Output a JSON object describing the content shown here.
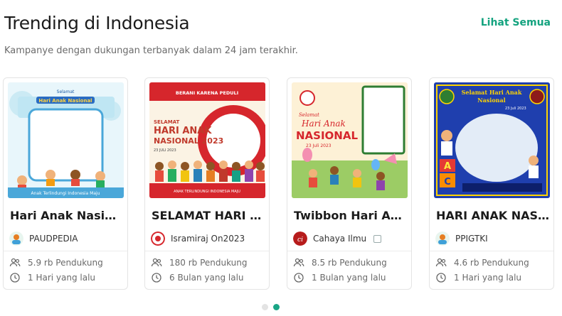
{
  "header": {
    "title": "Trending di Indonesia",
    "see_all": "Lihat Semua",
    "subtitle": "Kampanye dengan dukungan terbanyak dalam 24 jam terakhir."
  },
  "colors": {
    "accent": "#14a37f",
    "text": "#1c1c1c",
    "muted": "#6b6b6b"
  },
  "cards": [
    {
      "title": "Hari Anak Nasiona…",
      "creator": "PAUDPEDIA",
      "supporters": "5.9 rb Pendukung",
      "time": "1 Hari yang lalu",
      "thumb": {
        "line1": "Selamat",
        "line2": "Hari Anak Nasional",
        "footer": "Anak Terlindungi Indonesia Maju"
      }
    },
    {
      "title": "SELAMAT HARI AN…",
      "creator": "Isramiraj On2023",
      "supporters": "180 rb Pendukung",
      "time": "6 Bulan yang lalu",
      "thumb": {
        "banner": "BERANI KARENA PEDULI",
        "line1": "SELAMAT",
        "line2": "HARI ANAK",
        "line3": "NASIONAL 2023",
        "date": "23 JULI 2023",
        "footer": "ANAK TERLINDUNGI INDONESIA MAJU"
      }
    },
    {
      "title": "Twibbon Hari Ana…",
      "creator": "Cahaya Ilmu",
      "supporters": "8.5 rb Pendukung",
      "time": "1 Bulan yang lalu",
      "thumb": {
        "line1": "Selamat",
        "line2": "Hari Anak",
        "line3": "NASIONAL",
        "date": "23 Juli 2023"
      }
    },
    {
      "title": "HARI ANAK NASI…",
      "creator": "PPIGTKI",
      "supporters": "4.6 rb Pendukung",
      "time": "1 Hari yang lalu",
      "thumb": {
        "line1": "Selamat Hari Anak",
        "line2": "Nasional",
        "date": "23 Juli 2023"
      }
    }
  ],
  "pagination": {
    "pages": 2,
    "active": 2
  }
}
